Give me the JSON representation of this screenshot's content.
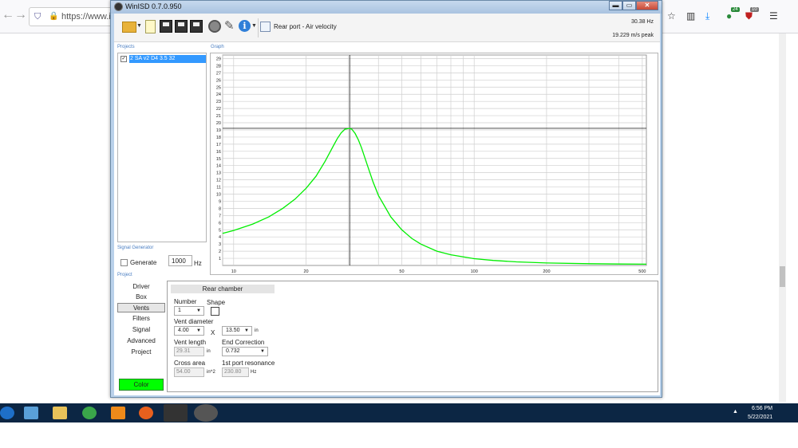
{
  "browser": {
    "url": "https://www.ig",
    "badge_green": "24",
    "badge_red": "10"
  },
  "window": {
    "title": "WinISD 0.7.0.950",
    "close_glyph": "✕",
    "minimize_glyph": "▬",
    "maximize_glyph": "▭"
  },
  "toolbar": {
    "graph_type": "Rear port - Air velocity",
    "info_glyph": "i",
    "tools_glyph": "✎"
  },
  "readout": {
    "frequency": "30.38 Hz",
    "peak": "19.229 m/s peak"
  },
  "sections": {
    "projects": "Projects",
    "graph": "Graph",
    "signal_generator": "Signal Generator",
    "project": "Project"
  },
  "projects": [
    {
      "name": "2 SA v2 D4 3.5 32",
      "checked": true,
      "check_glyph": "✓"
    }
  ],
  "signal_generator": {
    "generate_label": "Generate",
    "frequency": "1000",
    "unit": "Hz"
  },
  "nav": [
    "Driver",
    "Box",
    "Vents",
    "Filters",
    "Signal",
    "Advanced",
    "Project"
  ],
  "nav_selected": "Vents",
  "color_button": {
    "label": "Color",
    "color": "#00ff00"
  },
  "vents": {
    "tab": "Rear chamber",
    "number_label": "Number",
    "number_value": "1",
    "shape_label": "Shape",
    "diameter_label": "Vent diameter",
    "diameter_value": "4.00",
    "times": "X",
    "length_value2": "13.50",
    "in_unit": "in",
    "vent_length_label": "Vent length",
    "vent_length_value": "29.31",
    "end_correction_label": "End Correction",
    "end_correction_value": "0.732",
    "cross_area_label": "Cross area",
    "cross_area_value": "54.00",
    "cross_area_unit": "in^2",
    "port_res_label": "1st port resonance",
    "port_res_value": "230.80",
    "port_res_unit": "Hz",
    "dropdown_glyph": "▼"
  },
  "taskbar": {
    "time": "6:56 PM",
    "date": "5/22/2021",
    "tray_glyph": "▲"
  },
  "chart_data": {
    "type": "line",
    "title": "",
    "xlabel": "",
    "ylabel": "",
    "x_scale": "log",
    "xlim": [
      9,
      520
    ],
    "ylim": [
      0,
      29.5
    ],
    "x_ticks": [
      10,
      20,
      50,
      100,
      200,
      500
    ],
    "y_ticks": [
      1,
      2,
      3,
      4,
      5,
      6,
      7,
      8,
      9,
      10,
      11,
      12,
      13,
      14,
      15,
      16,
      17,
      18,
      19,
      20,
      21,
      22,
      23,
      24,
      25,
      26,
      27,
      28,
      29
    ],
    "grid": true,
    "cursor": {
      "x": 30.38,
      "y": 19.229
    },
    "series": [
      {
        "color": "#00ee00",
        "x": [
          9,
          10,
          12,
          14,
          16,
          18,
          20,
          22,
          24,
          26,
          27,
          28,
          29,
          30,
          30.38,
          31,
          32,
          33,
          34,
          36,
          38,
          40,
          45,
          50,
          55,
          60,
          70,
          80,
          100,
          120,
          150,
          200,
          300,
          400,
          520
        ],
        "y": [
          4.5,
          4.9,
          5.8,
          6.8,
          8.0,
          9.3,
          10.8,
          12.5,
          14.6,
          16.8,
          17.8,
          18.6,
          19.1,
          19.2,
          19.229,
          19.1,
          18.5,
          17.6,
          16.5,
          14.0,
          11.7,
          9.8,
          6.8,
          5.0,
          3.8,
          3.0,
          2.0,
          1.5,
          0.95,
          0.7,
          0.5,
          0.35,
          0.25,
          0.2,
          0.18
        ]
      }
    ]
  }
}
